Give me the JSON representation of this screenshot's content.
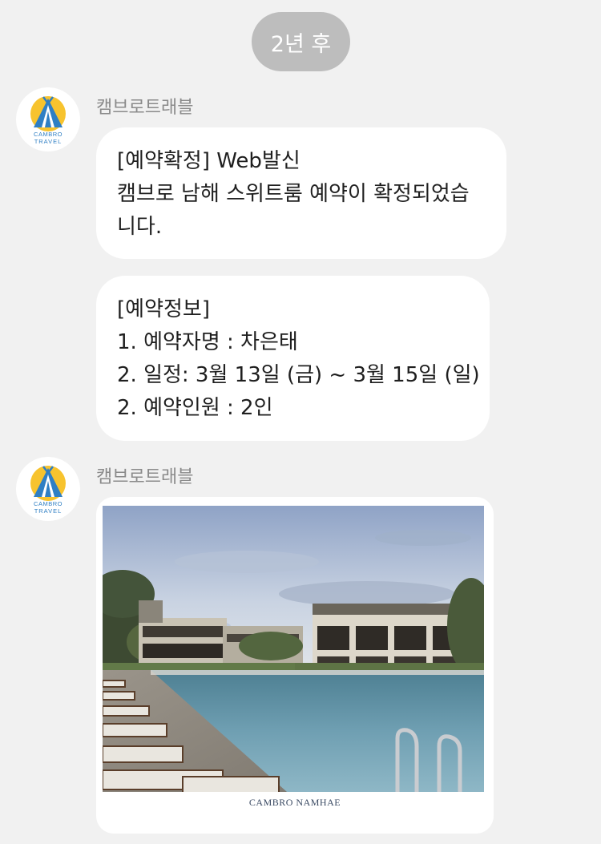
{
  "divider": {
    "time_label": "2년 후"
  },
  "messages": [
    {
      "sender": "캠브로트래블",
      "avatar_text": [
        "CAMBRO",
        "TRAVEL"
      ],
      "bubbles": [
        {
          "lines": [
            "[예약확정] Web발신",
            "캠브로 남해 스위트룸 예약이 확정되었습",
            "니다."
          ]
        },
        {
          "lines": [
            "[예약정보]",
            "1. 예약자명 : 차은태",
            "2. 일정: 3월 13일 (금) ~ 3월 15일 (일)",
            "2. 예약인원 : 2인"
          ]
        }
      ]
    },
    {
      "sender": "캠브로트래블",
      "avatar_text": [
        "CAMBRO",
        "TRAVEL"
      ],
      "image": {
        "caption": "CAMBRO NAMHAE"
      }
    }
  ],
  "colors": {
    "background": "#f1f1f1",
    "bubble": "#ffffff",
    "logo_sun": "#f7c32e",
    "logo_tent": "#2f7fc4"
  }
}
